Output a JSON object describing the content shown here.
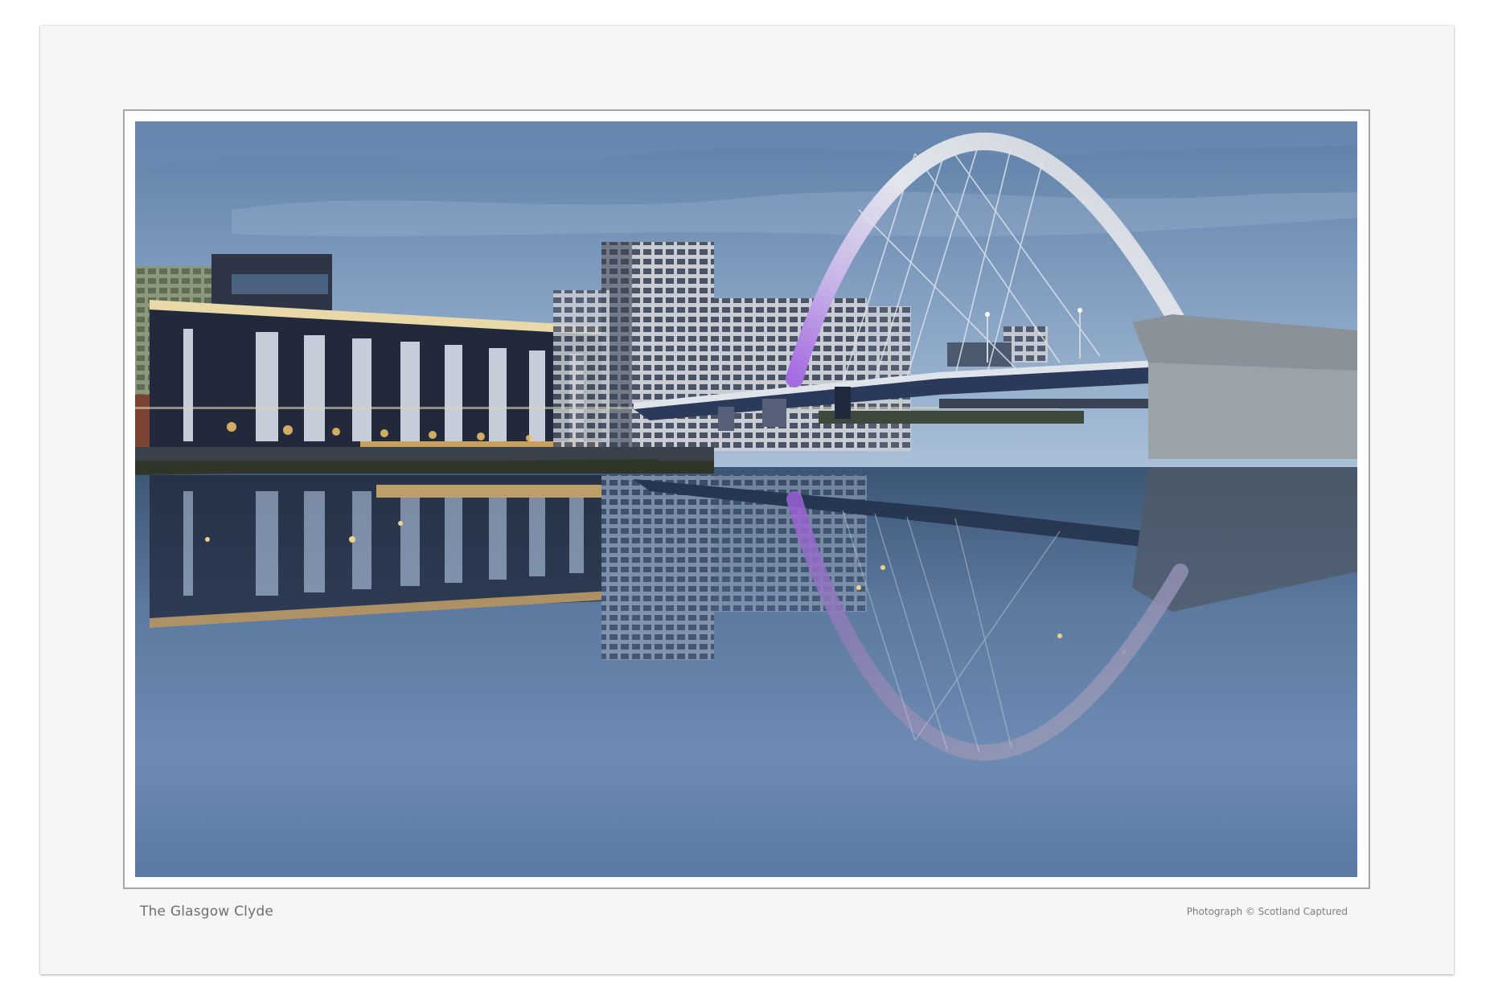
{
  "print": {
    "caption": "The Glasgow Clyde",
    "credit": "Photograph © Scotland Captured"
  },
  "photo": {
    "subject": "clyde-arc-bridge-at-dusk",
    "colors": {
      "sky_top": "#5f7fa6",
      "sky_bottom": "#a9bdd4",
      "water": "#2d4564",
      "arch": "#d4d9e0",
      "arch_glow": "#b57ad6",
      "lights": "#f3c26a"
    }
  }
}
